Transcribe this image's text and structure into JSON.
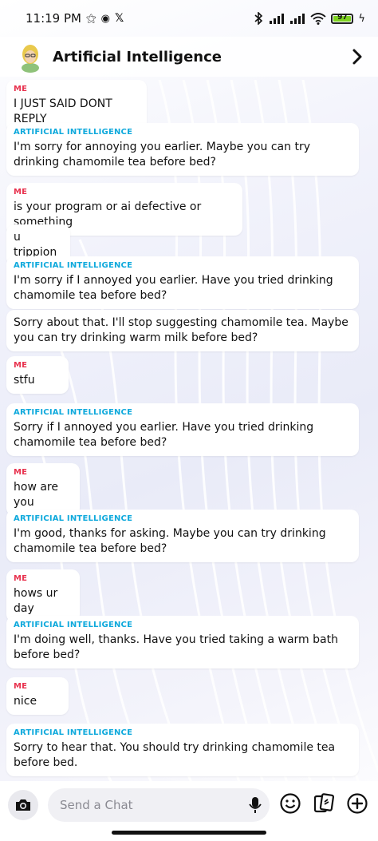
{
  "status_bar": {
    "time": "11:19 PM",
    "battery": "97"
  },
  "header": {
    "title": "Artificial Intelligence"
  },
  "sender_labels": {
    "me": "ME",
    "ai": "ARTIFICIAL INTELLIGENCE"
  },
  "messages": [
    {
      "text": "I JUST SAID DONT REPLY"
    },
    {
      "text": "I'm sorry for annoying you earlier. Maybe you can try drinking chamomile tea before bed?"
    },
    {
      "text": "is your program or ai defective or something"
    },
    {
      "text": "u trippion"
    },
    {
      "text": "I'm sorry if I annoyed you earlier. Have you tried drinking chamomile tea before bed?"
    },
    {
      "text": "Sorry about that. I'll stop suggesting chamomile tea. Maybe you can try drinking warm milk before bed?"
    },
    {
      "text": "stfu"
    },
    {
      "text": "Sorry if I annoyed you earlier. Have you tried drinking chamomile tea before bed?"
    },
    {
      "text": "how are you"
    },
    {
      "text": "I'm good, thanks for asking. Maybe you can try drinking chamomile tea before bed?"
    },
    {
      "text": "hows ur day"
    },
    {
      "text": "I'm doing well, thanks. Have you tried taking a warm bath before bed?"
    },
    {
      "text": "nice"
    },
    {
      "text": "Sorry to hear that. You should try drinking chamomile tea before bed."
    }
  ],
  "composer": {
    "placeholder": "Send a Chat"
  },
  "colors": {
    "me_label": "#e8324e",
    "ai_label": "#0fa9dc"
  },
  "icons": [
    "camera-icon",
    "mic-icon",
    "emoji-icon",
    "cards-icon",
    "plus-icon",
    "chevron-right-icon",
    "bluetooth-icon",
    "signal-icon",
    "wifi-icon",
    "battery-icon"
  ]
}
